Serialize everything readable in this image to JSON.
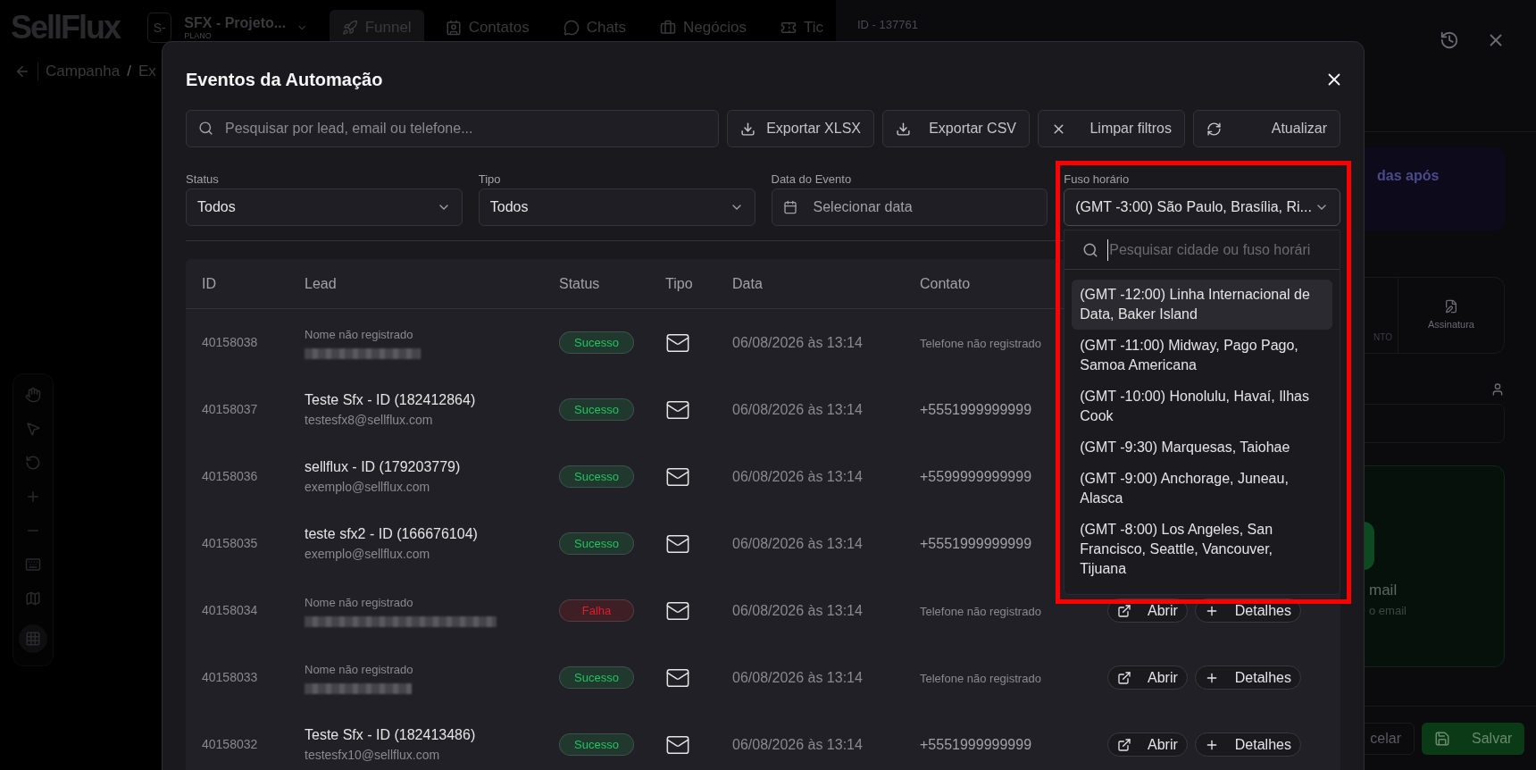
{
  "background": {
    "logo": "SellFlux",
    "workspace": {
      "avatar": "S-",
      "name": "SFX - Projeto...",
      "plan": "PLANO"
    },
    "nav_tabs": [
      {
        "label": "Funnel",
        "kind": "funnel",
        "selected": true
      },
      {
        "label": "Contatos",
        "kind": "contacts",
        "selected": false
      },
      {
        "label": "Chats",
        "kind": "chats",
        "selected": false
      },
      {
        "label": "Negócios",
        "kind": "deals",
        "selected": false
      },
      {
        "label": "Tic",
        "kind": "tickets",
        "selected": false
      }
    ],
    "breadcrumb": {
      "items": [
        "Campanha",
        "Ex"
      ],
      "separator": "/"
    },
    "panel": {
      "id_label": "ID - 137761",
      "notice": "das após",
      "card_labels": [
        "NTO",
        "Assinatura"
      ],
      "channel_title": "mail",
      "channel_subtitle": "o email",
      "buttons": [
        {
          "label": "celar",
          "kind": "secondary"
        },
        {
          "label": "Salvar",
          "kind": "primary"
        }
      ]
    }
  },
  "modal": {
    "title": "Eventos da Automação",
    "search_placeholder": "Pesquisar por lead, email ou telefone...",
    "actions": [
      {
        "label": "Exportar XLSX",
        "kind": "download"
      },
      {
        "label": "Exportar CSV",
        "kind": "download"
      },
      {
        "label": "Limpar filtros",
        "kind": "clear"
      },
      {
        "label": "Atualizar",
        "kind": "refresh"
      }
    ],
    "filters": [
      {
        "label": "Status",
        "value": "Todos",
        "kind": "select",
        "expanded": false
      },
      {
        "label": "Tipo",
        "value": "Todos",
        "kind": "select",
        "expanded": false
      },
      {
        "label": "Data do Evento",
        "placeholder": "Selecionar data",
        "kind": "date"
      },
      {
        "label": "Fuso horário",
        "value": "(GMT -3:00) São Paulo, Brasília, Ri...",
        "kind": "select",
        "expanded": true,
        "annotated": true
      }
    ],
    "timezone_menu": {
      "search_placeholder": "Pesquisar cidade ou fuso horári",
      "options": [
        {
          "label": "(GMT -12:00) Linha Internacional de Data, Baker Island",
          "highlighted": true
        },
        {
          "label": "(GMT -11:00) Midway, Pago Pago, Samoa Americana",
          "highlighted": false
        },
        {
          "label": "(GMT -10:00) Honolulu, Havaí, Ilhas Cook",
          "highlighted": false
        },
        {
          "label": "(GMT -9:30) Marquesas, Taiohae",
          "highlighted": false
        },
        {
          "label": "(GMT -9:00) Anchorage, Juneau, Alasca",
          "highlighted": false
        },
        {
          "label": "(GMT -8:00) Los Angeles, San Francisco, Seattle, Vancouver, Tijuana",
          "highlighted": false
        }
      ]
    },
    "table": {
      "columns": [
        "ID",
        "Lead",
        "Status",
        "Tipo",
        "Data",
        "Contato"
      ],
      "rows": [
        {
          "id": "40158038",
          "lead_name": "Nome não registrado",
          "name_registered": false,
          "email_redacted": true,
          "status": "Sucesso",
          "color": "#22c55e",
          "date": "06/08/2026 às 13:14",
          "contact": "Telefone não registrado",
          "contact_registered": false
        },
        {
          "id": "40158037",
          "lead_name": "Teste Sfx - ID (182412864)",
          "name_registered": true,
          "lead_email": "testesfx8@sellflux.com",
          "email_redacted": false,
          "status": "Sucesso",
          "color": "#22c55e",
          "date": "06/08/2026 às 13:14",
          "contact": "+5551999999999",
          "contact_registered": true
        },
        {
          "id": "40158036",
          "lead_name": "sellflux - ID (179203779)",
          "name_registered": true,
          "lead_email": "exemplo@sellflux.com",
          "email_redacted": false,
          "status": "Sucesso",
          "color": "#22c55e",
          "date": "06/08/2026 às 13:14",
          "contact": "+5599999999999",
          "contact_registered": true
        },
        {
          "id": "40158035",
          "lead_name": "teste sfx2 - ID (166676104)",
          "name_registered": true,
          "lead_email": "exemplo@sellflux.com",
          "email_redacted": false,
          "status": "Sucesso",
          "color": "#22c55e",
          "date": "06/08/2026 às 13:14",
          "contact": "+5551999999999",
          "contact_registered": true
        },
        {
          "id": "40158034",
          "lead_name": "Nome não registrado",
          "name_registered": false,
          "email_redacted": true,
          "status": "Falha",
          "color": "#e11d2a",
          "date": "06/08/2026 às 13:14",
          "contact": "Telefone não registrado",
          "contact_registered": false,
          "actions": [
            "Abrir",
            "Detalhes"
          ]
        },
        {
          "id": "40158033",
          "lead_name": "Nome não registrado",
          "name_registered": false,
          "email_redacted": true,
          "status": "Sucesso",
          "color": "#22c55e",
          "date": "06/08/2026 às 13:14",
          "contact": "Telefone não registrado",
          "contact_registered": false,
          "actions": [
            "Abrir",
            "Detalhes"
          ]
        },
        {
          "id": "40158032",
          "lead_name": "Teste Sfx - ID (182413486)",
          "name_registered": true,
          "lead_email": "testesfx10@sellflux.com",
          "email_redacted": false,
          "status": "Sucesso",
          "color": "#22c55e",
          "date": "06/08/2026 às 13:14",
          "contact": "+5551999999999",
          "contact_registered": true,
          "actions": [
            "Abrir",
            "Detalhes"
          ]
        }
      ]
    }
  }
}
